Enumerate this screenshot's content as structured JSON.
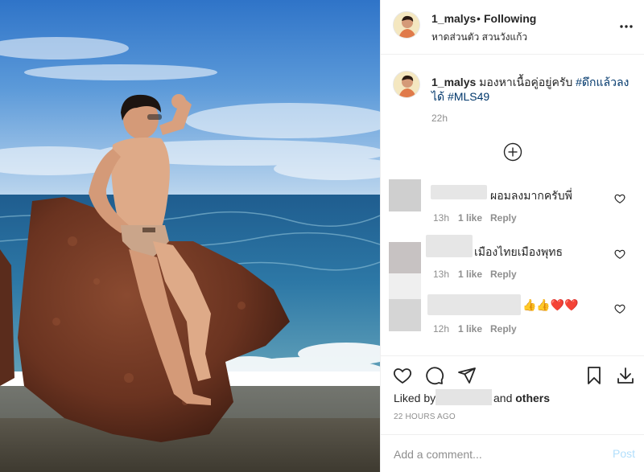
{
  "post": {
    "username": "1_malys",
    "dot": "•",
    "follow_status": "Following",
    "location": "หาดส่วนตัว สวนวังแก้ว",
    "more_icon": "more-horizontal-icon"
  },
  "caption": {
    "username": "1_malys",
    "text": "มองหาเนื้อคู่อยู่ครับ",
    "hashtag_1": "#ดึกแล้วลงได้",
    "hashtag_2": "#MLS49",
    "time": "22h",
    "load_more_icon": "plus-circle-icon"
  },
  "comments": [
    {
      "text": "ผอมลงมากครับพี่",
      "time": "13h",
      "likes": "1 like",
      "reply": "Reply"
    },
    {
      "text": "เมืองไทยเมืองพุทธ",
      "time": "13h",
      "likes": "1 like",
      "reply": "Reply"
    },
    {
      "text": "👍👍❤️❤️",
      "time": "12h",
      "likes": "1 like",
      "reply": "Reply"
    }
  ],
  "actions": {
    "icons": [
      "heart-icon",
      "comment-icon",
      "share-icon",
      "bookmark-icon",
      "download-icon"
    ],
    "liked_by_prefix": "Liked by",
    "liked_by_suffix_and": "and",
    "liked_by_suffix_others": "others",
    "time_ago": "22 HOURS AGO"
  },
  "add_comment": {
    "placeholder": "Add a comment...",
    "post_label": "Post"
  },
  "colors": {
    "link": "#00376b",
    "muted": "#8e8e8e",
    "post_disabled": "#b2dffc",
    "heart_emoji": "#e0245e"
  }
}
